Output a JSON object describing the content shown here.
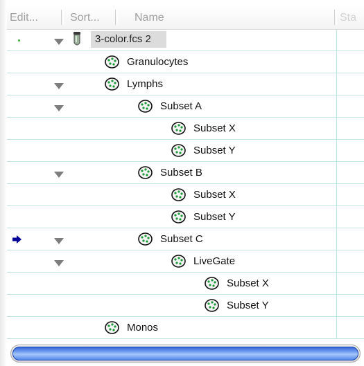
{
  "header": {
    "edit_label": "Edit...",
    "sort_label": "Sort...",
    "name_label": "Name",
    "status_label": "Sta"
  },
  "colors": {
    "grid_line": "#bfe6e1",
    "arrow": "#000099",
    "disclosure": "#7d7d7d",
    "scroll_thumb": "#4a80e8"
  },
  "rows": [
    {
      "label": "3-color.fcs 2",
      "icon": "sample-tube-icon",
      "expanded": true,
      "status_dot": true
    },
    {
      "label": "Granulocytes",
      "icon": "gate-icon",
      "expanded": false
    },
    {
      "label": "Lymphs",
      "icon": "gate-icon",
      "expanded": true
    },
    {
      "label": "Subset A",
      "icon": "gate-icon",
      "expanded": true
    },
    {
      "label": "Subset X",
      "icon": "gate-icon",
      "expanded": false
    },
    {
      "label": "Subset Y",
      "icon": "gate-icon",
      "expanded": false
    },
    {
      "label": "Subset B",
      "icon": "gate-icon",
      "expanded": true
    },
    {
      "label": "Subset X",
      "icon": "gate-icon",
      "expanded": false
    },
    {
      "label": "Subset Y",
      "icon": "gate-icon",
      "expanded": false
    },
    {
      "label": "Subset C",
      "icon": "gate-icon",
      "expanded": true,
      "current": true
    },
    {
      "label": "LiveGate",
      "icon": "gate-icon",
      "expanded": true
    },
    {
      "label": "Subset X",
      "icon": "gate-icon",
      "expanded": false
    },
    {
      "label": "Subset Y",
      "icon": "gate-icon",
      "expanded": false
    },
    {
      "label": "Monos",
      "icon": "gate-icon",
      "expanded": false
    }
  ]
}
